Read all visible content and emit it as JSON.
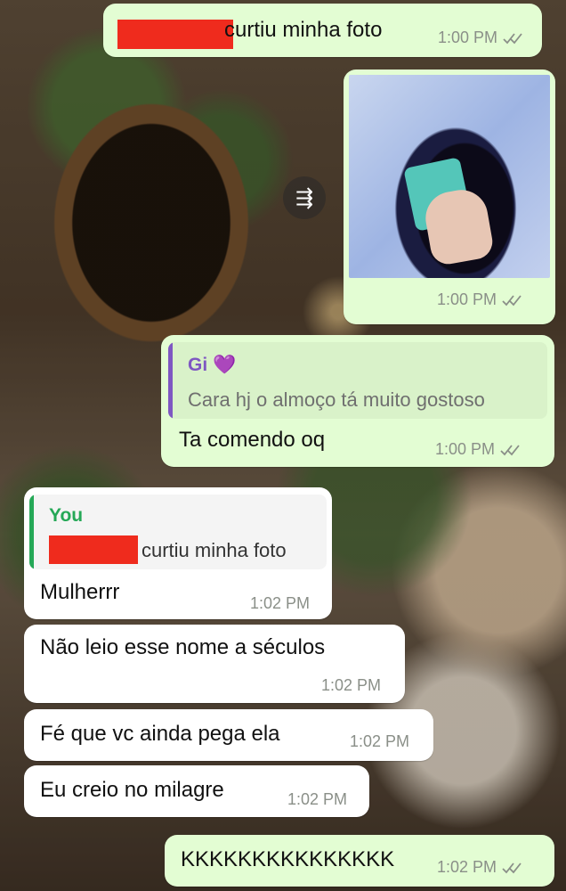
{
  "messages": {
    "m1": {
      "text": "curtiu minha foto",
      "time": "1:00 PM"
    },
    "m2": {
      "time": "1:00 PM",
      "forward_icon": "forward-icon"
    },
    "m3": {
      "quote_author": "Gi 💜",
      "quote_text": "Cara hj o almoço tá muito gostoso",
      "text": "Ta comendo oq",
      "time": "1:00 PM"
    },
    "m4": {
      "quote_author": "You",
      "quote_text": "curtiu minha foto",
      "text": "Mulherrr",
      "time": "1:02 PM"
    },
    "m5": {
      "text": "Não leio esse nome a séculos",
      "time": "1:02 PM"
    },
    "m6": {
      "text": "Fé que vc ainda pega ela",
      "time": "1:02 PM"
    },
    "m7": {
      "text": "Eu creio no milagre",
      "time": "1:02 PM"
    },
    "m8": {
      "text": "KKKKKKKKKKKKKKK",
      "time": "1:02 PM"
    }
  },
  "colors": {
    "outgoing_bubble": "#e3fdd3",
    "incoming_bubble": "#ffffff",
    "quote_gi": "#7e57c2",
    "quote_you": "#25a857",
    "redaction": "#ef2b1d",
    "read_ticks": "#8a8f88"
  }
}
